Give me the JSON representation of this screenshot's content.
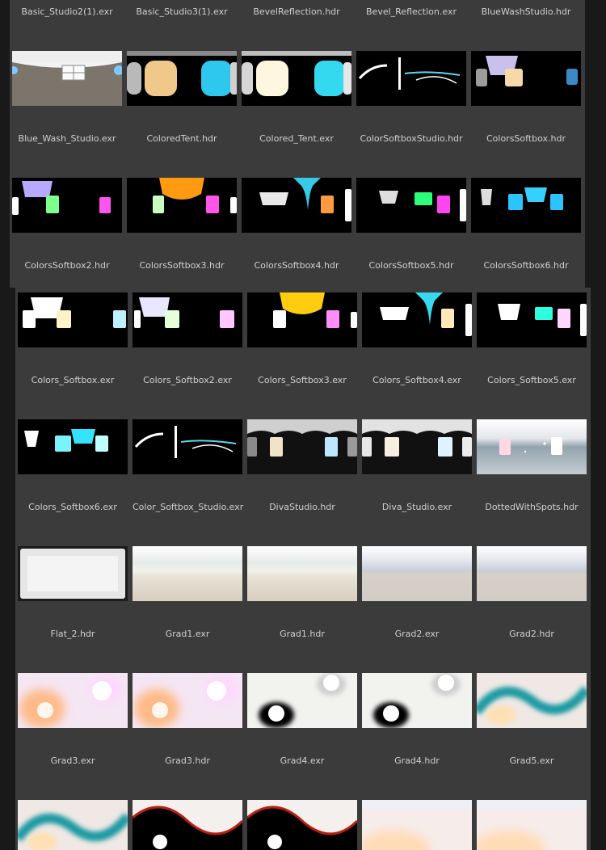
{
  "top_panel": {
    "row_labels": [
      [
        "Basic_Studio2(1).exr",
        "Basic_Studio3(1).exr",
        "BevelReflection.hdr",
        "Bevel_Reflection.exr",
        "BlueWashStudio.hdr"
      ],
      [
        "Blue_Wash_Studio.exr",
        "ColoredTent.hdr",
        "Colored_Tent.exr",
        "ColorSoftboxStudio.hdr",
        "ColorsSoftbox.hdr"
      ],
      [
        "ColorsSoftbox2.hdr",
        "ColorsSoftbox3.hdr",
        "ColorsSoftbox4.hdr",
        "ColorsSoftbox5.hdr",
        "ColorsSoftbox6.hdr"
      ]
    ],
    "thumb_rows": [
      [
        "studio-room",
        "studio-orbs-warm-cyan",
        "studio-orbs-white-cyan",
        "light-streaks",
        "blue-wash"
      ],
      [
        "softbox-purple-green-pink",
        "colored-tent-orange",
        "softbox-cyan-orange",
        "softbox-green-pink",
        "softbox-cyan"
      ]
    ]
  },
  "bottom_panel": {
    "row_labels": [
      [
        "Colors_Softbox.exr",
        "Colors_Softbox2.exr",
        "Colors_Softbox3.exr",
        "Colors_Softbox4.exr",
        "Colors_Softbox5.exr"
      ],
      [
        "Colors_Softbox6.exr",
        "Color_Softbox_Studio.exr",
        "DivaStudio.hdr",
        "Diva_Studio.exr",
        "DottedWithSpots.hdr"
      ],
      [
        "Flat_2.hdr",
        "Grad1.exr",
        "Grad1.hdr",
        "Grad2.exr",
        "Grad2.hdr"
      ],
      [
        "Grad3.exr",
        "Grad3.hdr",
        "Grad4.exr",
        "Grad4.hdr",
        "Grad5.exr"
      ]
    ],
    "thumb_rows": [
      [
        "softbox-white",
        "softbox-purple-pink",
        "softbox-yellow",
        "softbox-cyan-tent",
        "softbox-cyan-white"
      ],
      [
        "softbox-cyan-trio",
        "light-streaks",
        "diva-studio",
        "diva-studio-2",
        "dotted-with-spots"
      ],
      [
        "flat-white",
        "gradient-beige",
        "gradient-beige",
        "gradient-gray",
        "gradient-gray"
      ],
      [
        "gradient-pink-orbs",
        "gradient-pink-orbs",
        "gradient-black-blobs",
        "gradient-black-blobs",
        "gradient-teal-wave"
      ],
      [
        "gradient-teal-wave",
        "gradient-red-wave",
        "gradient-red-wave",
        "gradient-peach",
        "gradient-peach"
      ]
    ]
  }
}
